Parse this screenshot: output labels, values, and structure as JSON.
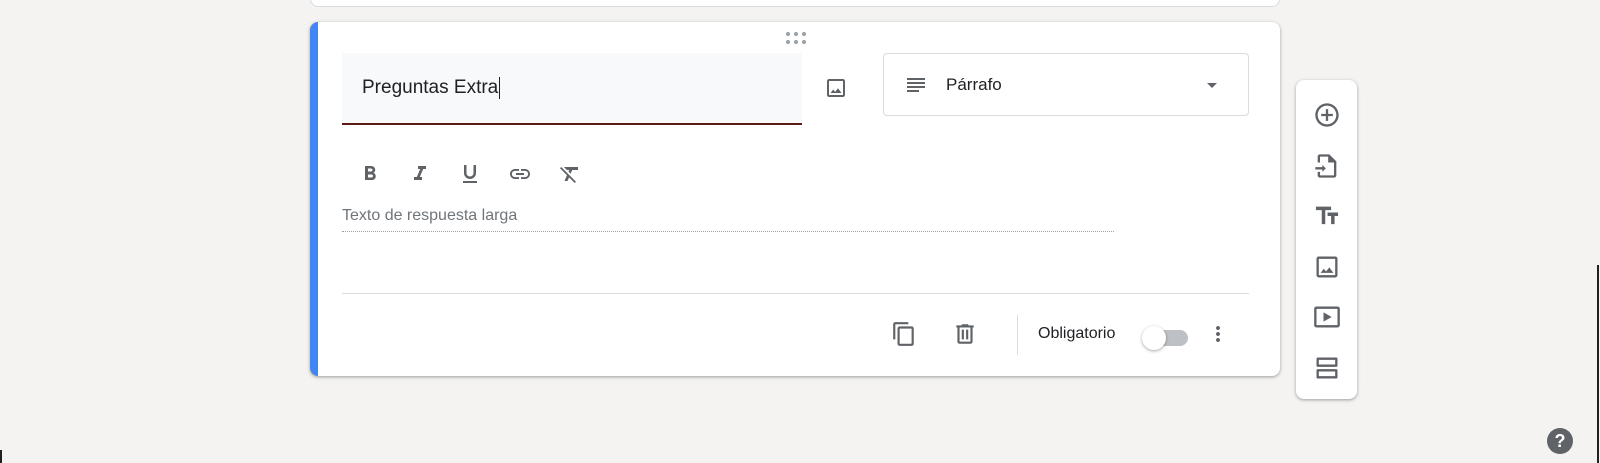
{
  "question": {
    "title": "Preguntas Extra",
    "type_label": "Párrafo",
    "answer_placeholder": "Texto de respuesta larga",
    "required_label": "Obligatorio",
    "required": false
  },
  "formatting": [
    "bold-icon",
    "italic-icon",
    "underline-icon",
    "link-icon",
    "clear-format-icon"
  ],
  "side_toolbar": [
    "add-question-icon",
    "import-questions-icon",
    "add-title-icon",
    "add-image-icon",
    "add-video-icon",
    "add-section-icon"
  ],
  "help_label": "?",
  "colors": {
    "accent": "#4285f4",
    "title_underline": "#5b1a13",
    "icon": "#5f6368",
    "background": "#f4f3f1"
  }
}
